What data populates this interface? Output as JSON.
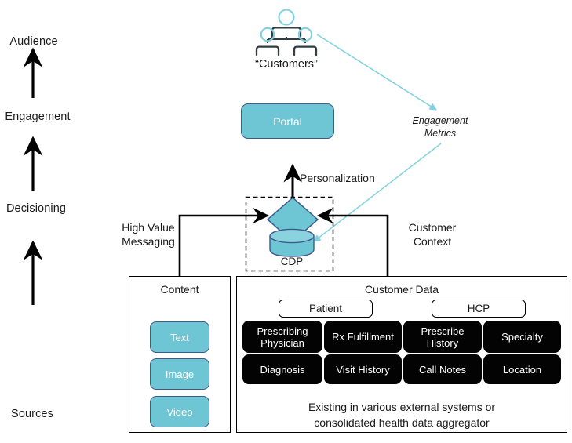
{
  "diagram": {
    "title_visible": false,
    "colors": {
      "teal_fill": "#6EC6D4",
      "teal_border": "#3C5A8C",
      "cyan_arrow": "#7FD2DF",
      "chip_fill": "#030303",
      "line_black": "#000000",
      "text": "#1A1A1A"
    }
  },
  "stages": [
    {
      "label": "Audience"
    },
    {
      "label": "Engagement"
    },
    {
      "label": "Decisioning"
    },
    {
      "label": "Sources"
    }
  ],
  "audience": {
    "icon": "org-chart-people-icon",
    "caption": "“Customers”"
  },
  "engagement": {
    "portal_label": "Portal",
    "metrics_label_line1": "Engagement",
    "metrics_label_line2": "Metrics"
  },
  "decisioning": {
    "cdp_label": "CDP",
    "diamond_icon": "decision-diamond-icon",
    "database_icon": "database-cylinder-icon",
    "personalization_label": "Personalization",
    "left_edge_label_line1": "High Value",
    "left_edge_label_line2": "Messaging",
    "right_edge_label_line1": "Customer",
    "right_edge_label_line2": "Context"
  },
  "content_panel": {
    "title": "Content",
    "items": [
      {
        "label": "Text"
      },
      {
        "label": "Image"
      },
      {
        "label": "Video"
      }
    ]
  },
  "customer_data_panel": {
    "title": "Customer Data",
    "groups": [
      {
        "label": "Patient"
      },
      {
        "label": "HCP"
      }
    ],
    "chips": [
      {
        "label": "Prescribing Physician"
      },
      {
        "label": "Rx Fulfillment"
      },
      {
        "label": "Prescribe History"
      },
      {
        "label": "Specialty"
      },
      {
        "label": "Diagnosis"
      },
      {
        "label": "Visit History"
      },
      {
        "label": "Call Notes"
      },
      {
        "label": "Location"
      }
    ],
    "footnote_line1": "Existing in various external systems or",
    "footnote_line2": "consolidated health data aggregator"
  }
}
